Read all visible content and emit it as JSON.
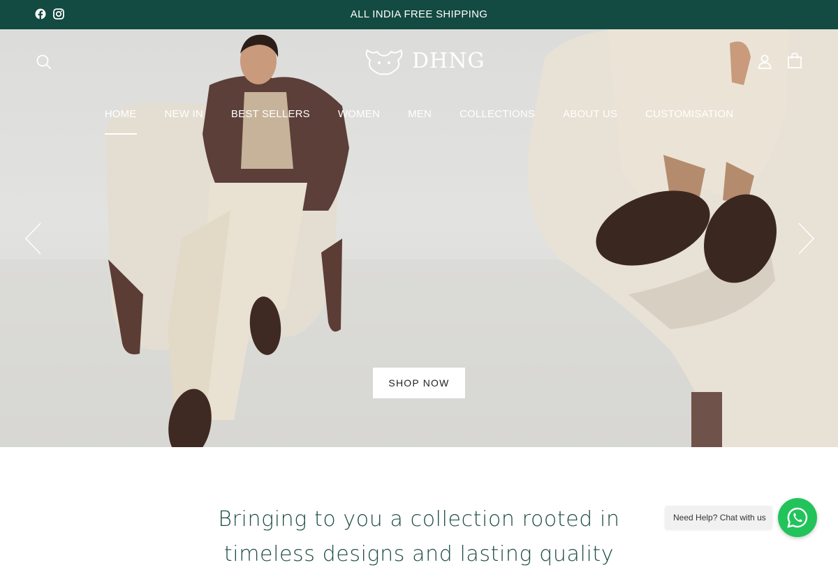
{
  "announcement": {
    "text": "ALL INDIA FREE SHIPPING",
    "socials": [
      {
        "icon": "facebook-icon"
      },
      {
        "icon": "instagram-icon"
      }
    ]
  },
  "header": {
    "brand": "DHNG",
    "icons": {
      "search": "search-icon",
      "account": "account-icon",
      "cart": "cart-icon"
    }
  },
  "nav": {
    "items": [
      {
        "label": "HOME",
        "active": true
      },
      {
        "label": "NEW IN"
      },
      {
        "label": "BEST SELLERS"
      },
      {
        "label": "WOMEN"
      },
      {
        "label": "MEN"
      },
      {
        "label": "COLLECTIONS"
      },
      {
        "label": "ABOUT US"
      },
      {
        "label": "CUSTOMISATION"
      }
    ]
  },
  "hero": {
    "cta_label": "SHOP NOW",
    "prev_icon": "chevron-left-icon",
    "next_icon": "chevron-right-icon"
  },
  "intro": {
    "text": "Bringing to you a collection rooted in timeless designs and lasting quality"
  },
  "chat": {
    "label": "Need Help? Chat with us",
    "icon": "whatsapp-icon",
    "color": "#23c35b"
  },
  "colors": {
    "brand_green": "#134a41",
    "text_green": "#1e4d44"
  }
}
